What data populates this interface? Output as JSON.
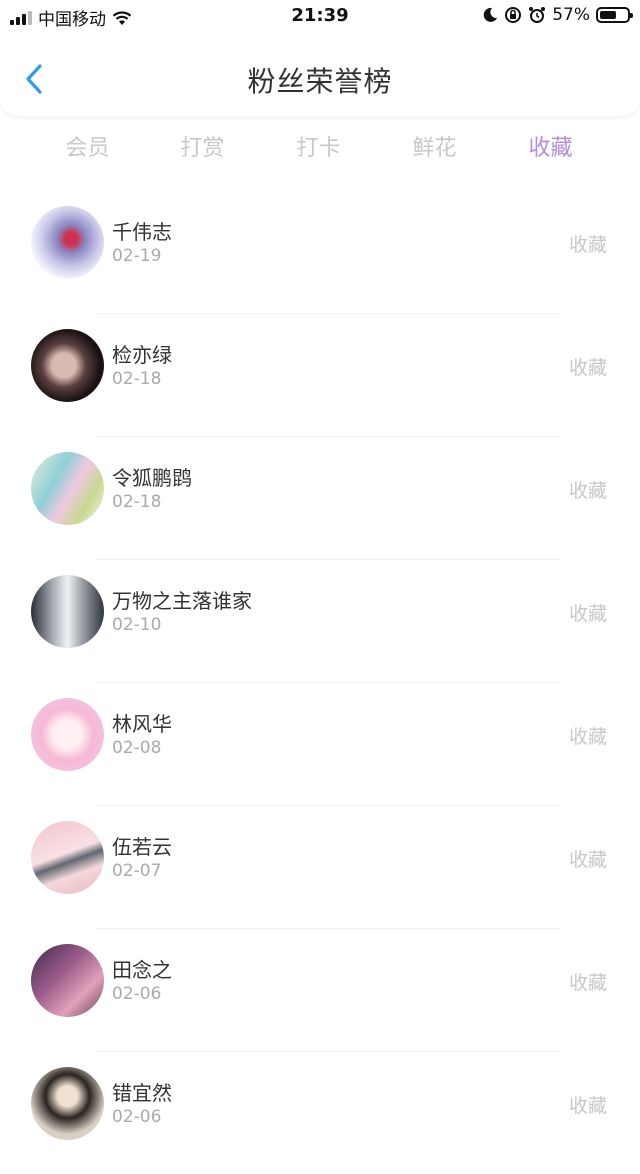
{
  "status_bar": {
    "carrier": "中国移动",
    "time": "21:39",
    "battery": "57%"
  },
  "header": {
    "title": "粉丝荣誉榜",
    "back_icon": "chevron-left-icon"
  },
  "tabs": [
    {
      "label": "会员",
      "active": false
    },
    {
      "label": "打赏",
      "active": false
    },
    {
      "label": "打卡",
      "active": false
    },
    {
      "label": "鲜花",
      "active": false
    },
    {
      "label": "收藏",
      "active": true
    }
  ],
  "accent_color": "#b48be0",
  "fans": [
    {
      "name": "千伟志",
      "date": "02-19",
      "action": "收藏"
    },
    {
      "name": "检亦绿",
      "date": "02-18",
      "action": "收藏"
    },
    {
      "name": "令狐鹏鹍",
      "date": "02-18",
      "action": "收藏"
    },
    {
      "name": "万物之主落谁家",
      "date": "02-10",
      "action": "收藏"
    },
    {
      "name": "林风华",
      "date": "02-08",
      "action": "收藏"
    },
    {
      "name": "伍若云",
      "date": "02-07",
      "action": "收藏"
    },
    {
      "name": "田念之",
      "date": "02-06",
      "action": "收藏"
    },
    {
      "name": "错宜然",
      "date": "02-06",
      "action": "收藏"
    }
  ]
}
